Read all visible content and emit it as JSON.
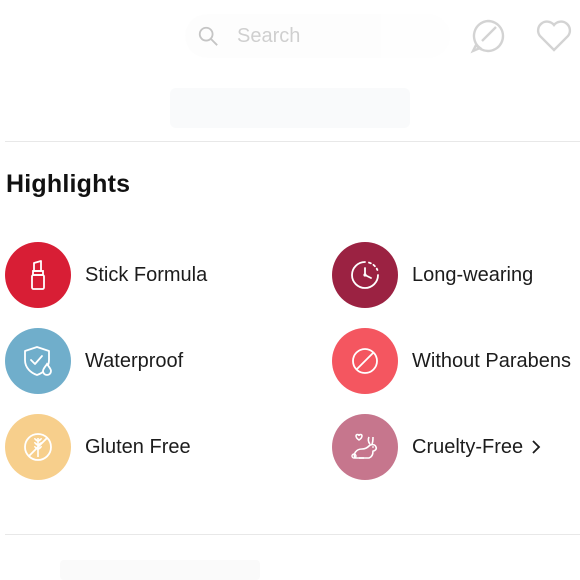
{
  "header": {
    "search_placeholder": "Search",
    "icons": [
      "search-icon",
      "chat-bubble-icon",
      "heart-icon"
    ]
  },
  "section": {
    "title": "Highlights"
  },
  "highlights": [
    {
      "label": "Stick Formula",
      "icon": "lipstick-icon",
      "color": "#d81e35"
    },
    {
      "label": "Long-wearing",
      "icon": "stopwatch-icon",
      "color": "#9b2242"
    },
    {
      "label": "Waterproof",
      "icon": "shield-drop-icon",
      "color": "#70aecb"
    },
    {
      "label": "Without Parabens",
      "icon": "prohibited-icon",
      "color": "#f45660"
    },
    {
      "label": "Gluten Free",
      "icon": "no-wheat-icon",
      "color": "#f7cf8c"
    },
    {
      "label": "Cruelty-Free",
      "icon": "rabbit-heart-icon",
      "color": "#c6768d"
    }
  ]
}
